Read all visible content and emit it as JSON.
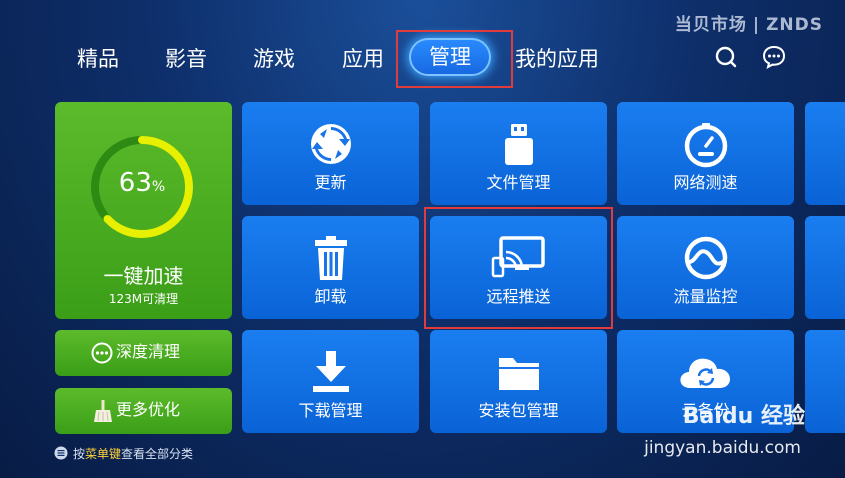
{
  "watermark": {
    "brand_cn": "当贝市场",
    "brand_en": "ZNDS"
  },
  "nav": {
    "tabs": [
      {
        "label": "精品"
      },
      {
        "label": "影音"
      },
      {
        "label": "游戏"
      },
      {
        "label": "应用"
      },
      {
        "label": "管理",
        "active": true
      },
      {
        "label": "我的应用"
      }
    ],
    "search_icon": "search-icon",
    "message_icon": "message-icon"
  },
  "speedup": {
    "percent": "63",
    "percent_sign": "%",
    "percent_value": 0.63,
    "title": "一键加速",
    "subtitle": "123M可清理"
  },
  "side_buttons": [
    {
      "label": "深度清理",
      "icon": "more-dots-icon"
    },
    {
      "label": "更多优化",
      "icon": "broom-icon"
    }
  ],
  "tiles": [
    {
      "label": "更新",
      "icon": "update-icon"
    },
    {
      "label": "文件管理",
      "icon": "usb-drive-icon"
    },
    {
      "label": "网络测速",
      "icon": "speedometer-icon"
    },
    {
      "label": "卸载",
      "icon": "trash-icon"
    },
    {
      "label": "远程推送",
      "icon": "cast-screen-icon"
    },
    {
      "label": "流量监控",
      "icon": "wave-gauge-icon"
    },
    {
      "label": "下载管理",
      "icon": "download-icon"
    },
    {
      "label": "安装包管理",
      "icon": "folder-icon"
    },
    {
      "label": "云备份",
      "icon": "cloud-sync-icon"
    }
  ],
  "hint": {
    "prefix": "按",
    "key": "菜单键",
    "suffix": "查看全部分类"
  },
  "baidu_watermark": {
    "logo_text": "Baidu 经验",
    "url": "jingyan.baidu.com"
  },
  "colors": {
    "tile_blue": "#0a63d6",
    "tile_green": "#3a9e17",
    "ring_progress": "#e6f000",
    "highlight_red": "#e23b3b",
    "hint_key": "#ffd23a"
  }
}
